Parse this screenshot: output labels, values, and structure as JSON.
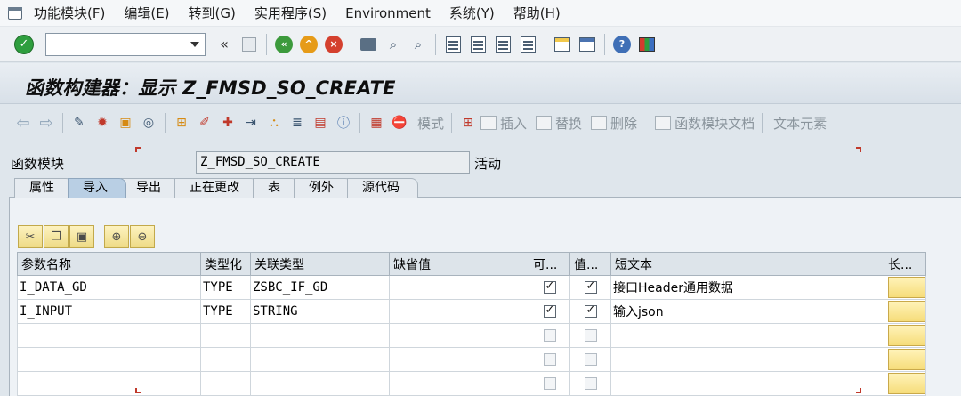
{
  "menu": {
    "items": [
      {
        "label": "功能模块(F)"
      },
      {
        "label": "编辑(E)"
      },
      {
        "label": "转到(G)"
      },
      {
        "label": "实用程序(S)"
      },
      {
        "label": "Environment"
      },
      {
        "label": "系统(Y)"
      },
      {
        "label": "帮助(H)"
      }
    ]
  },
  "toolbar": {
    "command_value": "",
    "back_glyph": "«"
  },
  "title": {
    "text": "函数构建器：显示 Z_FMSD_SO_CREATE"
  },
  "app_toolbar": {
    "mode_label": "模式",
    "insert_label": "插入",
    "replace_label": "替换",
    "delete_label": "删除",
    "fm_doc_label": "函数模块文档",
    "text_elements_label": "文本元素"
  },
  "field": {
    "label": "函数模块",
    "value": "Z_FMSD_SO_CREATE",
    "status": "活动"
  },
  "tabs": [
    {
      "label": "属性",
      "active": false
    },
    {
      "label": "导入",
      "active": true
    },
    {
      "label": "导出",
      "active": false
    },
    {
      "label": "正在更改",
      "active": false
    },
    {
      "label": "表",
      "active": false
    },
    {
      "label": "例外",
      "active": false
    },
    {
      "label": "源代码",
      "active": false
    }
  ],
  "grid": {
    "headers": {
      "param": "参数名称",
      "typing": "类型化",
      "ref_type": "关联类型",
      "default": "缺省值",
      "optional": "可...",
      "pass_value": "值...",
      "short_text": "短文本",
      "long_text": "长..."
    },
    "rows": [
      {
        "param": "I_DATA_GD",
        "typing": "TYPE",
        "ref_type": "ZSBC_IF_GD",
        "default": "",
        "optional": true,
        "pass_value": true,
        "short_text": "接口Header通用数据"
      },
      {
        "param": "I_INPUT",
        "typing": "TYPE",
        "ref_type": "STRING",
        "default": "",
        "optional": true,
        "pass_value": true,
        "short_text": "输入json"
      },
      {
        "param": "",
        "typing": "",
        "ref_type": "",
        "default": "",
        "optional": false,
        "pass_value": false,
        "short_text": ""
      },
      {
        "param": "",
        "typing": "",
        "ref_type": "",
        "default": "",
        "optional": false,
        "pass_value": false,
        "short_text": ""
      },
      {
        "param": "",
        "typing": "",
        "ref_type": "",
        "default": "",
        "optional": false,
        "pass_value": false,
        "short_text": ""
      }
    ]
  },
  "colors": {
    "accent": "#2e9e3e",
    "active_tab": "#b9cfe4",
    "marker": "#c0392b"
  },
  "icons": {
    "std": [
      "ok-icon",
      "save-icon",
      "back-icon",
      "exit-icon",
      "cancel-icon",
      "print-icon",
      "find-icon",
      "find-next-icon",
      "first-page-icon",
      "prev-page-icon",
      "next-page-icon",
      "last-page-icon",
      "new-session-icon",
      "shortcut-icon",
      "help-icon",
      "customize-layout-icon"
    ]
  }
}
